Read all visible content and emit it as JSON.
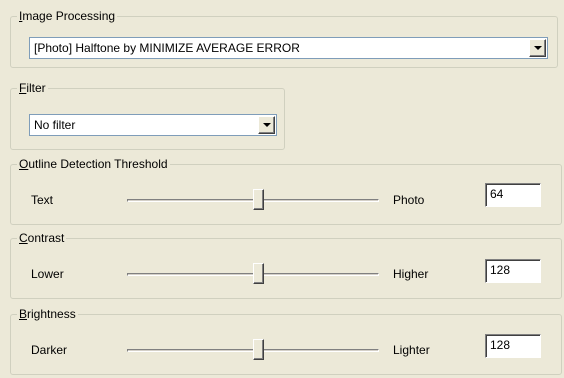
{
  "image_processing": {
    "legend_acc": "I",
    "legend_rest": "mage Processing",
    "selected": "[Photo] Halftone by MINIMIZE AVERAGE ERROR"
  },
  "filter": {
    "legend_acc": "F",
    "legend_rest": "ilter",
    "selected": "No filter"
  },
  "outline": {
    "legend_acc": "O",
    "legend_rest": "utline Detection Threshold",
    "left_label": "Text",
    "right_label": "Photo",
    "value": "64"
  },
  "contrast": {
    "legend_acc": "C",
    "legend_rest": "ontrast",
    "left_label": "Lower",
    "right_label": "Higher",
    "value": "128"
  },
  "brightness": {
    "legend_acc": "B",
    "legend_rest": "rightness",
    "left_label": "Darker",
    "right_label": "Lighter",
    "value": "128"
  },
  "icons": {
    "combo_arrow": "chevron-down-icon"
  }
}
